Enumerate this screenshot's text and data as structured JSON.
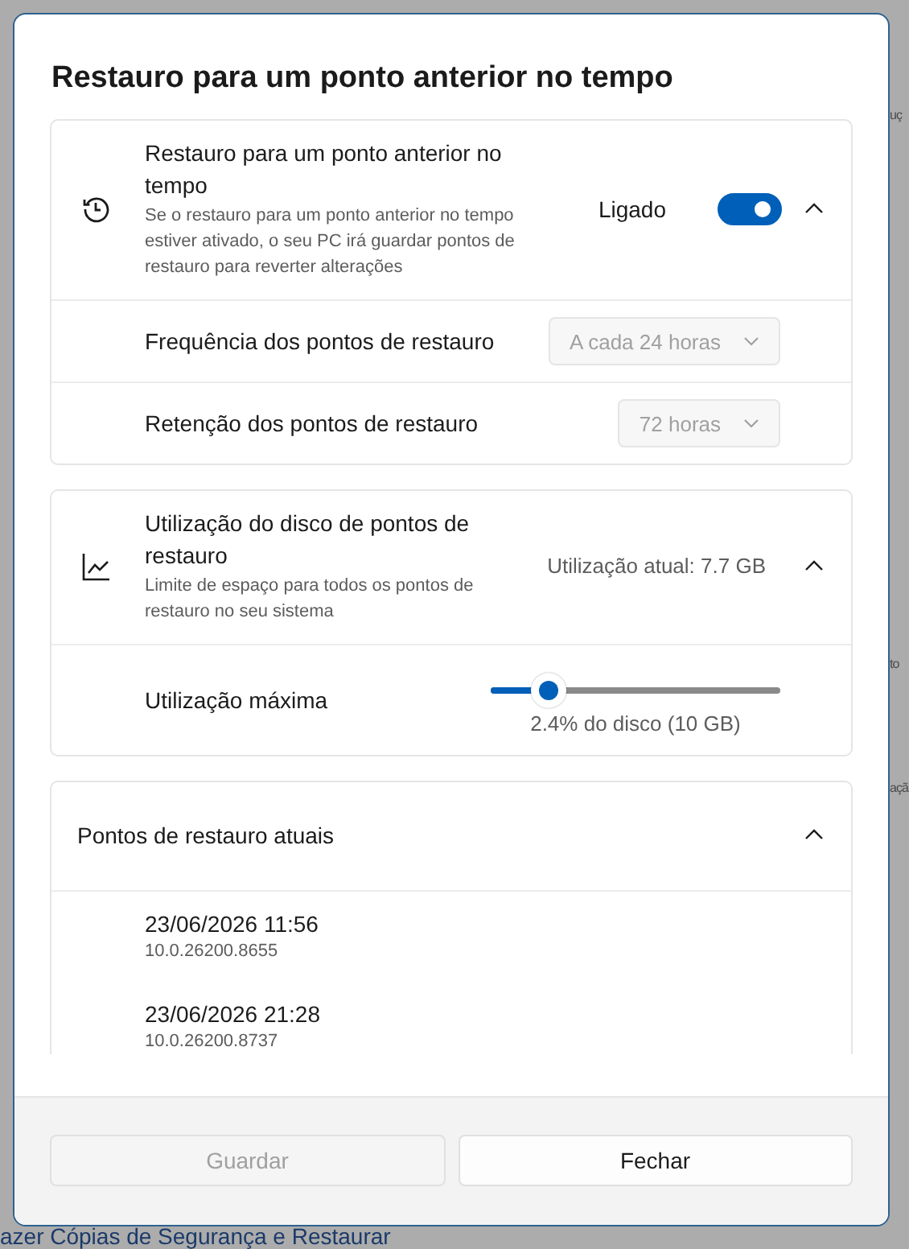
{
  "background": {
    "right_fragments": [
      {
        "text": "uç",
        "kind": "sub"
      },
      {
        "text": "to",
        "kind": "sub"
      },
      {
        "text": "açã",
        "kind": "sub"
      }
    ],
    "bottom_link": "azer Cópias de Segurança e Restaurar"
  },
  "dialog": {
    "title": "Restauro para um ponto anterior no tempo",
    "restore_card": {
      "title": "Restauro para um ponto anterior no tempo",
      "description": "Se o restauro para um ponto anterior no tempo estiver ativado, o seu PC irá guardar pontos de restauro para reverter alterações",
      "state_label": "Ligado",
      "on": true,
      "expanded": true,
      "settings": [
        {
          "label": "Frequência dos pontos de restauro",
          "value": "A cada 24 horas",
          "disabled": true
        },
        {
          "label": "Retenção dos pontos de restauro",
          "value": "72 horas",
          "disabled": true
        }
      ]
    },
    "disk_card": {
      "title": "Utilização do disco de pontos de restauro",
      "description": "Limite de espaço para todos os pontos de restauro no seu sistema",
      "usage": "Utilização atual: 7.7 GB",
      "expanded": true,
      "slider_label": "Utilização máxima",
      "level": 0.2,
      "reading": "2.4% do disco (10 GB)"
    },
    "points_card": {
      "title": "Pontos de restauro atuais",
      "expanded": true,
      "points": [
        {
          "date": "23/06/2026 11:56",
          "version": "10.0.26200.8655"
        },
        {
          "date": "23/06/2026 21:28",
          "version": "10.0.26200.8737"
        }
      ]
    },
    "buttons": [
      {
        "label": "Guardar",
        "disabled": true
      },
      {
        "label": "Fechar",
        "disabled": false
      }
    ]
  }
}
